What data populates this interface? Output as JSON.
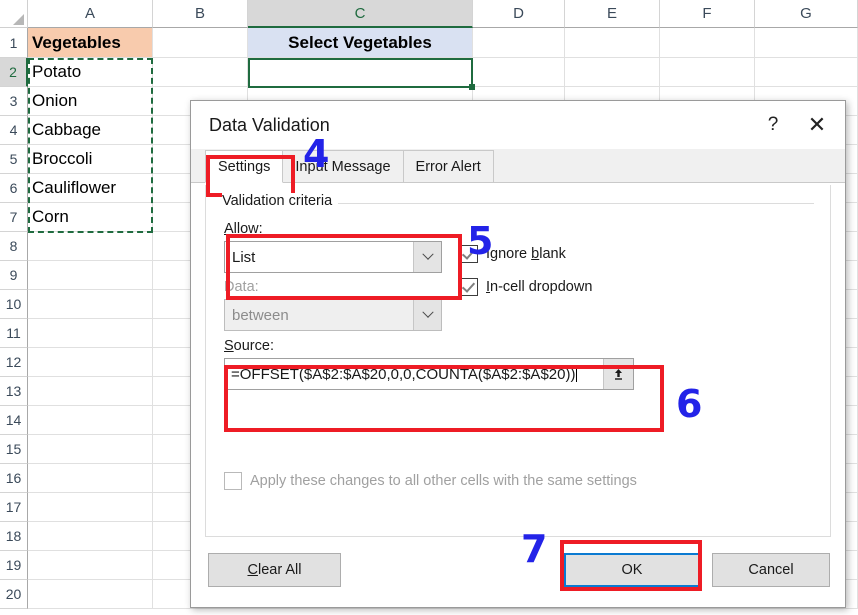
{
  "spreadsheet": {
    "column_headers": [
      "A",
      "B",
      "C",
      "D",
      "E",
      "F",
      "G"
    ],
    "active_column": "C",
    "active_row": "2",
    "row_headers": [
      "1",
      "2",
      "3",
      "4",
      "5",
      "6",
      "7",
      "8",
      "9",
      "10",
      "11",
      "12",
      "13",
      "14",
      "15",
      "16",
      "17",
      "18",
      "19",
      "20"
    ],
    "cells": {
      "A1": "Vegetables",
      "A2": "Potato",
      "A3": "Onion",
      "A4": "Cabbage",
      "A5": "Broccoli",
      "A6": "Cauliflower",
      "A7": "Corn",
      "C1": "Select Vegetables",
      "C2": ""
    },
    "colors": {
      "header_a_fill": "#f8cbad",
      "header_c_fill": "#d9e1f2",
      "selection_green": "#1f6b3f",
      "gridline": "#e0e0e0"
    },
    "copied_range": "A2:A7",
    "selected_cell": "C2"
  },
  "dialog": {
    "title": "Data Validation",
    "help_icon": "?",
    "close_icon": "✕",
    "tabs": [
      {
        "label": "Settings",
        "selected": true
      },
      {
        "label": "Input Message",
        "selected": false
      },
      {
        "label": "Error Alert",
        "selected": false
      }
    ],
    "group_label": "Validation criteria",
    "allow": {
      "label": "Allow:",
      "label_accel": "A",
      "value": "List",
      "chevron_icon": "chevron-down-icon"
    },
    "data": {
      "label": "Data:",
      "value": "between",
      "disabled": true,
      "chevron_icon": "chevron-down-icon"
    },
    "source": {
      "label": "Source:",
      "label_accel": "S",
      "value": "=OFFSET($A$2:$A$20,0,0,COUNTA($A$2:$A$20))",
      "picker_icon": "range-picker-icon"
    },
    "checkboxes": [
      {
        "label": "Ignore blank",
        "accel": "b",
        "checked": true
      },
      {
        "label": "In-cell dropdown",
        "accel": "I",
        "checked": true
      }
    ],
    "apply_all": {
      "label": "Apply these changes to all other cells with the same settings",
      "checked": false,
      "disabled": true
    },
    "buttons": {
      "clear_all": "Clear All",
      "clear_all_accel": "C",
      "ok": "OK",
      "cancel": "Cancel"
    }
  },
  "annotations": {
    "numbers": [
      "4",
      "5",
      "6",
      "7"
    ],
    "highlight_color": "#ee1c25",
    "number_color": "#2323e8"
  }
}
